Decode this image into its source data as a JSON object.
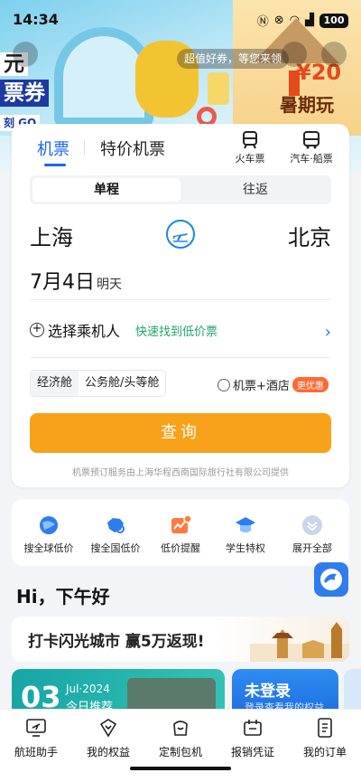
{
  "status_bar": {
    "time": "14:34",
    "signal_text": "ℕ ⁂ ◢",
    "battery": "100"
  },
  "banner": {
    "promo_line1": "元",
    "promo_line2": "票券",
    "promo_go": "刻 GO",
    "coupon_tip": "超值好券，等您来领",
    "right_big": "¥20",
    "right_sub": "暑期玩"
  },
  "booking": {
    "tabs": [
      "机票",
      "特价机票"
    ],
    "active_tab": "机票",
    "mini_links": [
      {
        "label": "火车票",
        "icon": "train-icon"
      },
      {
        "label": "汽车·船票",
        "icon": "bus-icon"
      }
    ],
    "trip_types": [
      "单程",
      "往返"
    ],
    "from_city": "上海",
    "to_city": "北京",
    "date": "7月4日",
    "date_sub": "明天",
    "passenger_label": "选择乘机人",
    "low_price_link": "快速找到低价票",
    "cabins": [
      "经济舱",
      "公务舱/头等舱"
    ],
    "hotel_label": "机票+酒店",
    "hotel_badge": "更优惠",
    "query_button": "查询",
    "provider_text": "机票预订服务由上海华程西南国际旅行社有限公司提供"
  },
  "quick_links": [
    {
      "label": "搜全球低价",
      "icon": "globe-icon"
    },
    {
      "label": "搜全国低价",
      "icon": "china-map-icon"
    },
    {
      "label": "低价提醒",
      "icon": "price-alert-icon"
    },
    {
      "label": "学生特权",
      "icon": "graduation-cap-icon"
    },
    {
      "label": "展开全部",
      "icon": "expand-all-icon"
    }
  ],
  "greeting": "Hi，下午好",
  "checkin_banner": "打卡闪光城市 赢5万返现!",
  "promo_cards": {
    "day": "03",
    "month": "Jul·2024",
    "recommend": "今日推荐",
    "login_title": "未登录",
    "login_sub": "登录查看我的权益"
  },
  "bottom_nav": [
    {
      "label": "航班助手",
      "icon": "flight-monitor-icon"
    },
    {
      "label": "我的权益",
      "icon": "benefits-icon"
    },
    {
      "label": "定制包机",
      "icon": "charter-icon"
    },
    {
      "label": "报销凭证",
      "icon": "receipt-icon"
    },
    {
      "label": "我的订单",
      "icon": "orders-icon"
    }
  ],
  "colors": {
    "accent": "#1a66e8",
    "query": "#f7a21a",
    "green": "#1fa56b"
  }
}
